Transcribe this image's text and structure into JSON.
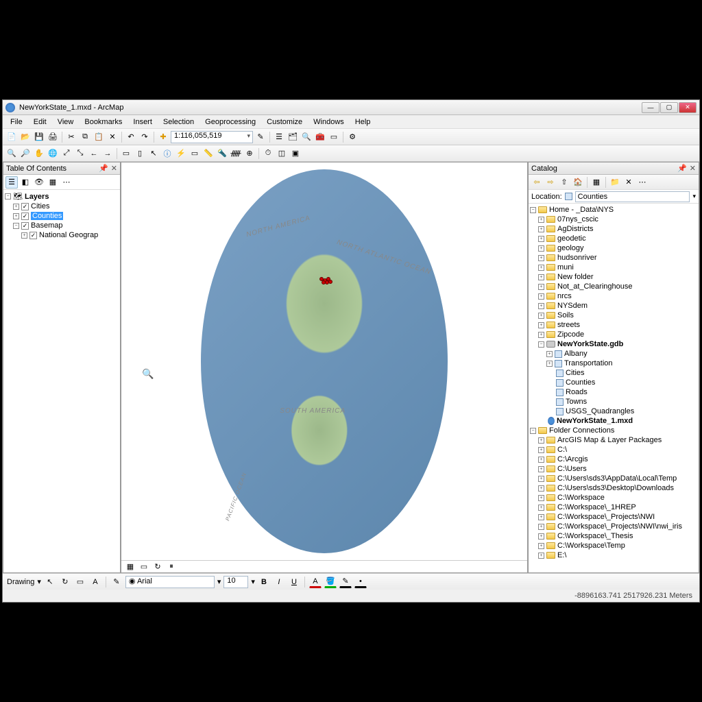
{
  "window": {
    "title": "NewYorkState_1.mxd - ArcMap"
  },
  "menu": [
    "File",
    "Edit",
    "View",
    "Bookmarks",
    "Insert",
    "Selection",
    "Geoprocessing",
    "Customize",
    "Windows",
    "Help"
  ],
  "scale": "1:116,055,519",
  "toc": {
    "title": "Table Of Contents",
    "root": "Layers",
    "items": [
      {
        "label": "Cities",
        "checked": true
      },
      {
        "label": "Counties",
        "checked": true,
        "selected": true
      },
      {
        "label": "Basemap",
        "checked": true,
        "expanded": true,
        "children": [
          {
            "label": "National Geograp",
            "checked": true
          }
        ]
      }
    ]
  },
  "map": {
    "labels": {
      "na": "NORTH AMERICA",
      "sa": "SOUTH AMERICA",
      "atl": "NORTH ATLANTIC OCEAN",
      "pac": "PACIFIC OCEAN"
    }
  },
  "catalog": {
    "title": "Catalog",
    "location_label": "Location:",
    "location_value": "Counties",
    "home": "Home - _Data\\NYS",
    "folders": [
      "07nys_cscic",
      "AgDistricts",
      "geodetic",
      "geology",
      "hudsonriver",
      "muni",
      "New folder",
      "Not_at_Clearinghouse",
      "nrcs",
      "NYSdem",
      "Soils",
      "streets",
      "Zipcode"
    ],
    "gdb": {
      "name": "NewYorkState.gdb",
      "datasets": [
        "Albany",
        "Transportation"
      ],
      "fcs": [
        "Cities",
        "Counties",
        "Roads",
        "Towns",
        "USGS_Quadrangles"
      ]
    },
    "mxd": "NewYorkState_1.mxd",
    "connections_label": "Folder Connections",
    "connections": [
      "ArcGIS Map & Layer Packages",
      "C:\\",
      "C:\\Arcgis",
      "C:\\Users",
      "C:\\Users\\sds3\\AppData\\Local\\Temp",
      "C:\\Users\\sds3\\Desktop\\Downloads",
      "C:\\Workspace",
      "C:\\Workspace\\_1HREP",
      "C:\\Workspace\\_Projects\\NWI",
      "C:\\Workspace\\_Projects\\NWI\\nwi_iris",
      "C:\\Workspace\\_Thesis",
      "C:\\Workspace\\Temp",
      "E:\\"
    ]
  },
  "drawing": {
    "label": "Drawing",
    "font": "Arial",
    "size": "10"
  },
  "status": {
    "coords": "-8896163.741  2517926.231 Meters"
  }
}
